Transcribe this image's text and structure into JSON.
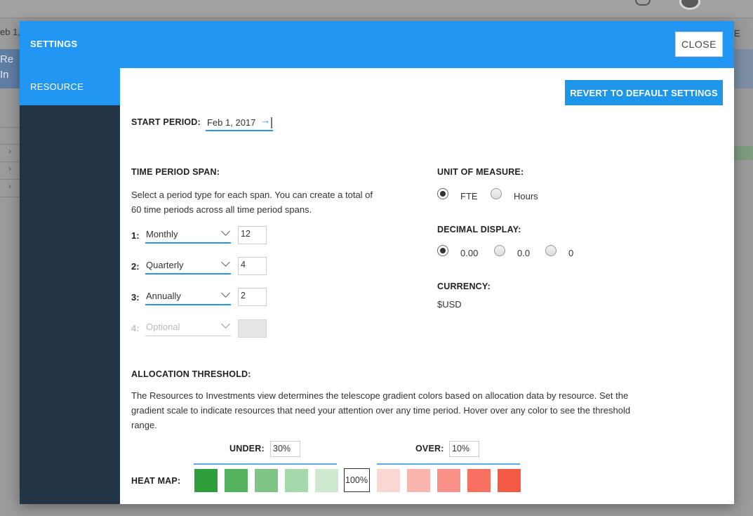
{
  "background": {
    "tab_left": "eb 1,",
    "tab_right": "E",
    "row_text_1": "Re",
    "row_text_2": "In"
  },
  "modal": {
    "title": "SETTINGS",
    "close_label": "CLOSE",
    "sidebar": {
      "items": [
        {
          "label": "RESOURCE",
          "active": true
        }
      ]
    },
    "revert_label": "REVERT TO DEFAULT SETTINGS",
    "start_period": {
      "label": "START PERIOD:",
      "value": "Feb 1, 2017"
    },
    "time_period_span": {
      "label": "TIME PERIOD SPAN:",
      "description_line1": "Select a period type for each span. You can create a total of",
      "description_line2": "60 time periods across all time period spans.",
      "spans": [
        {
          "num": "1:",
          "type": "Monthly",
          "count": "12",
          "enabled": true
        },
        {
          "num": "2:",
          "type": "Quarterly",
          "count": "4",
          "enabled": true
        },
        {
          "num": "3:",
          "type": "Annually",
          "count": "2",
          "enabled": true
        },
        {
          "num": "4:",
          "type": "Optional",
          "count": "",
          "enabled": false
        }
      ]
    },
    "unit_of_measure": {
      "label": "UNIT OF MEASURE:",
      "options": [
        {
          "label": "FTE",
          "checked": true
        },
        {
          "label": "Hours",
          "checked": false
        }
      ]
    },
    "decimal_display": {
      "label": "DECIMAL DISPLAY:",
      "options": [
        {
          "label": "0.00",
          "checked": true
        },
        {
          "label": "0.0",
          "checked": false
        },
        {
          "label": "0",
          "checked": false
        }
      ]
    },
    "currency": {
      "label": "CURRENCY:",
      "value": "$USD"
    },
    "allocation_threshold": {
      "label": "ALLOCATION THRESHOLD:",
      "description_line1": "The Resources to Investments view determines the telescope gradient colors based on allocation data by resource. Set the",
      "description_line2": "gradient scale to indicate resources that need your attention over any time period. Hover over any color to see the threshold",
      "description_line3": "range.",
      "under_label": "UNDER:",
      "under_value": "30%",
      "over_label": "OVER:",
      "over_value": "10%",
      "heat_map_label": "HEAT MAP:",
      "center_value": "100%",
      "under_colors": [
        "#2e9e3b",
        "#55b35f",
        "#7fc686",
        "#a5d8aa",
        "#cdeacf"
      ],
      "over_colors": [
        "#fbd7d3",
        "#f9b5ae",
        "#f99189",
        "#f87062",
        "#f55a45"
      ]
    },
    "colors": {
      "header": "#2196f3",
      "sidebar": "#223445",
      "accent": "#2196f3"
    }
  }
}
